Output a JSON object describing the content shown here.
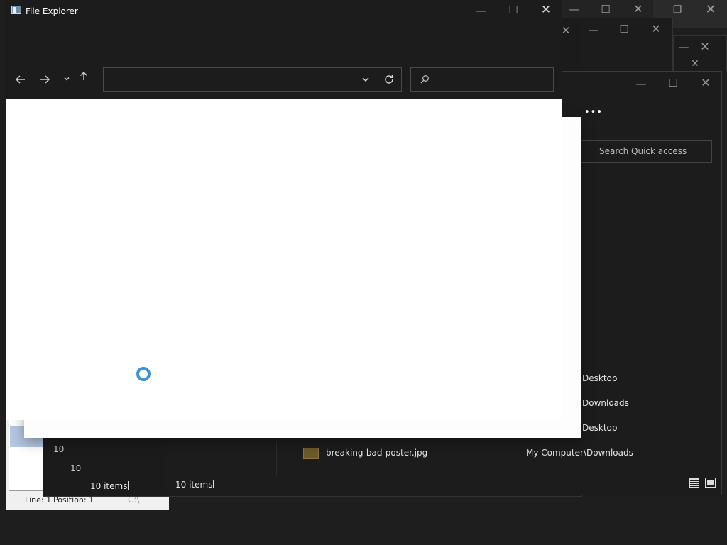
{
  "main_window": {
    "title": "File Explorer",
    "address_placeholder": "",
    "search_placeholder": ""
  },
  "quick_access_window": {
    "search_placeholder": "Search Quick access",
    "more_label": "•••",
    "rows": [
      {
        "location": "Desktop"
      },
      {
        "location": "Downloads"
      },
      {
        "location": "Desktop"
      }
    ],
    "file": {
      "name": "breaking-bad-poster.jpg",
      "location": "My Computer\\Downloads"
    },
    "status_count": "10 items"
  },
  "back_window": {
    "status_count": "10 items",
    "numbers": [
      "10",
      "10"
    ]
  },
  "notepad": {
    "status_line": "Line: 1",
    "status_position": "Position: 1",
    "drive_fragment": "C:\\"
  },
  "colors": {
    "titlebar": "#1c1c1c",
    "content": "#ffffff",
    "spinner": "#3c93d7"
  }
}
